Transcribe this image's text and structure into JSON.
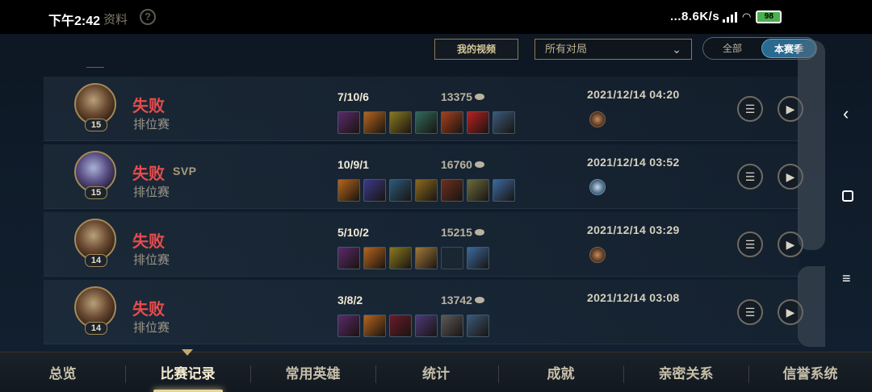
{
  "status_bar": {
    "time": "下午2:42",
    "back_label": "资料",
    "network_speed": "...8.6K/s",
    "battery": "98"
  },
  "filters": {
    "my_videos": "我的视频",
    "match_type_selected": "所有对局",
    "segments": [
      "全部",
      "本赛季"
    ],
    "segment_active": "本赛季"
  },
  "matches": [
    {
      "level": "15",
      "result": "失败",
      "badge": "",
      "mode": "排位赛",
      "kda": "7/10/6",
      "gold": "13375",
      "date": "2021/12/14 04:20",
      "medal": "bronze",
      "items": [
        "#5a2a6a",
        "#b5651d",
        "#8a7a20",
        "#2f6a5a",
        "#a5401d",
        "#b82020",
        "#3a5a7a"
      ]
    },
    {
      "level": "15",
      "result": "失败",
      "badge": "SVP",
      "mode": "排位赛",
      "kda": "10/9/1",
      "gold": "16760",
      "date": "2021/12/14 03:52",
      "medal": "silver",
      "items": [
        "#b5651d",
        "#3a3a8a",
        "#2a5a7a",
        "#8a6a20",
        "#6a3020",
        "#6a6a40",
        "#3a6aa0"
      ]
    },
    {
      "level": "14",
      "result": "失败",
      "badge": "",
      "mode": "排位赛",
      "kda": "5/10/2",
      "gold": "15215",
      "date": "2021/12/14 03:29",
      "medal": "bronze",
      "items": [
        "#5a2a6a",
        "#b5651d",
        "#8a7a20",
        "#a07a3a",
        "empty",
        "#3a6aa0"
      ]
    },
    {
      "level": "14",
      "result": "失败",
      "badge": "",
      "mode": "排位赛",
      "kda": "3/8/2",
      "gold": "13742",
      "date": "2021/12/14 03:08",
      "medal": "",
      "items": [
        "#5a2a6a",
        "#b5651d",
        "#6a1a2a",
        "#4a3a7a",
        "#5a5a5a",
        "#3a5a7a"
      ]
    }
  ],
  "tabs": [
    "总览",
    "比赛记录",
    "常用英雄",
    "统计",
    "成就",
    "亲密关系",
    "信誉系统"
  ],
  "active_tab": "比赛记录"
}
